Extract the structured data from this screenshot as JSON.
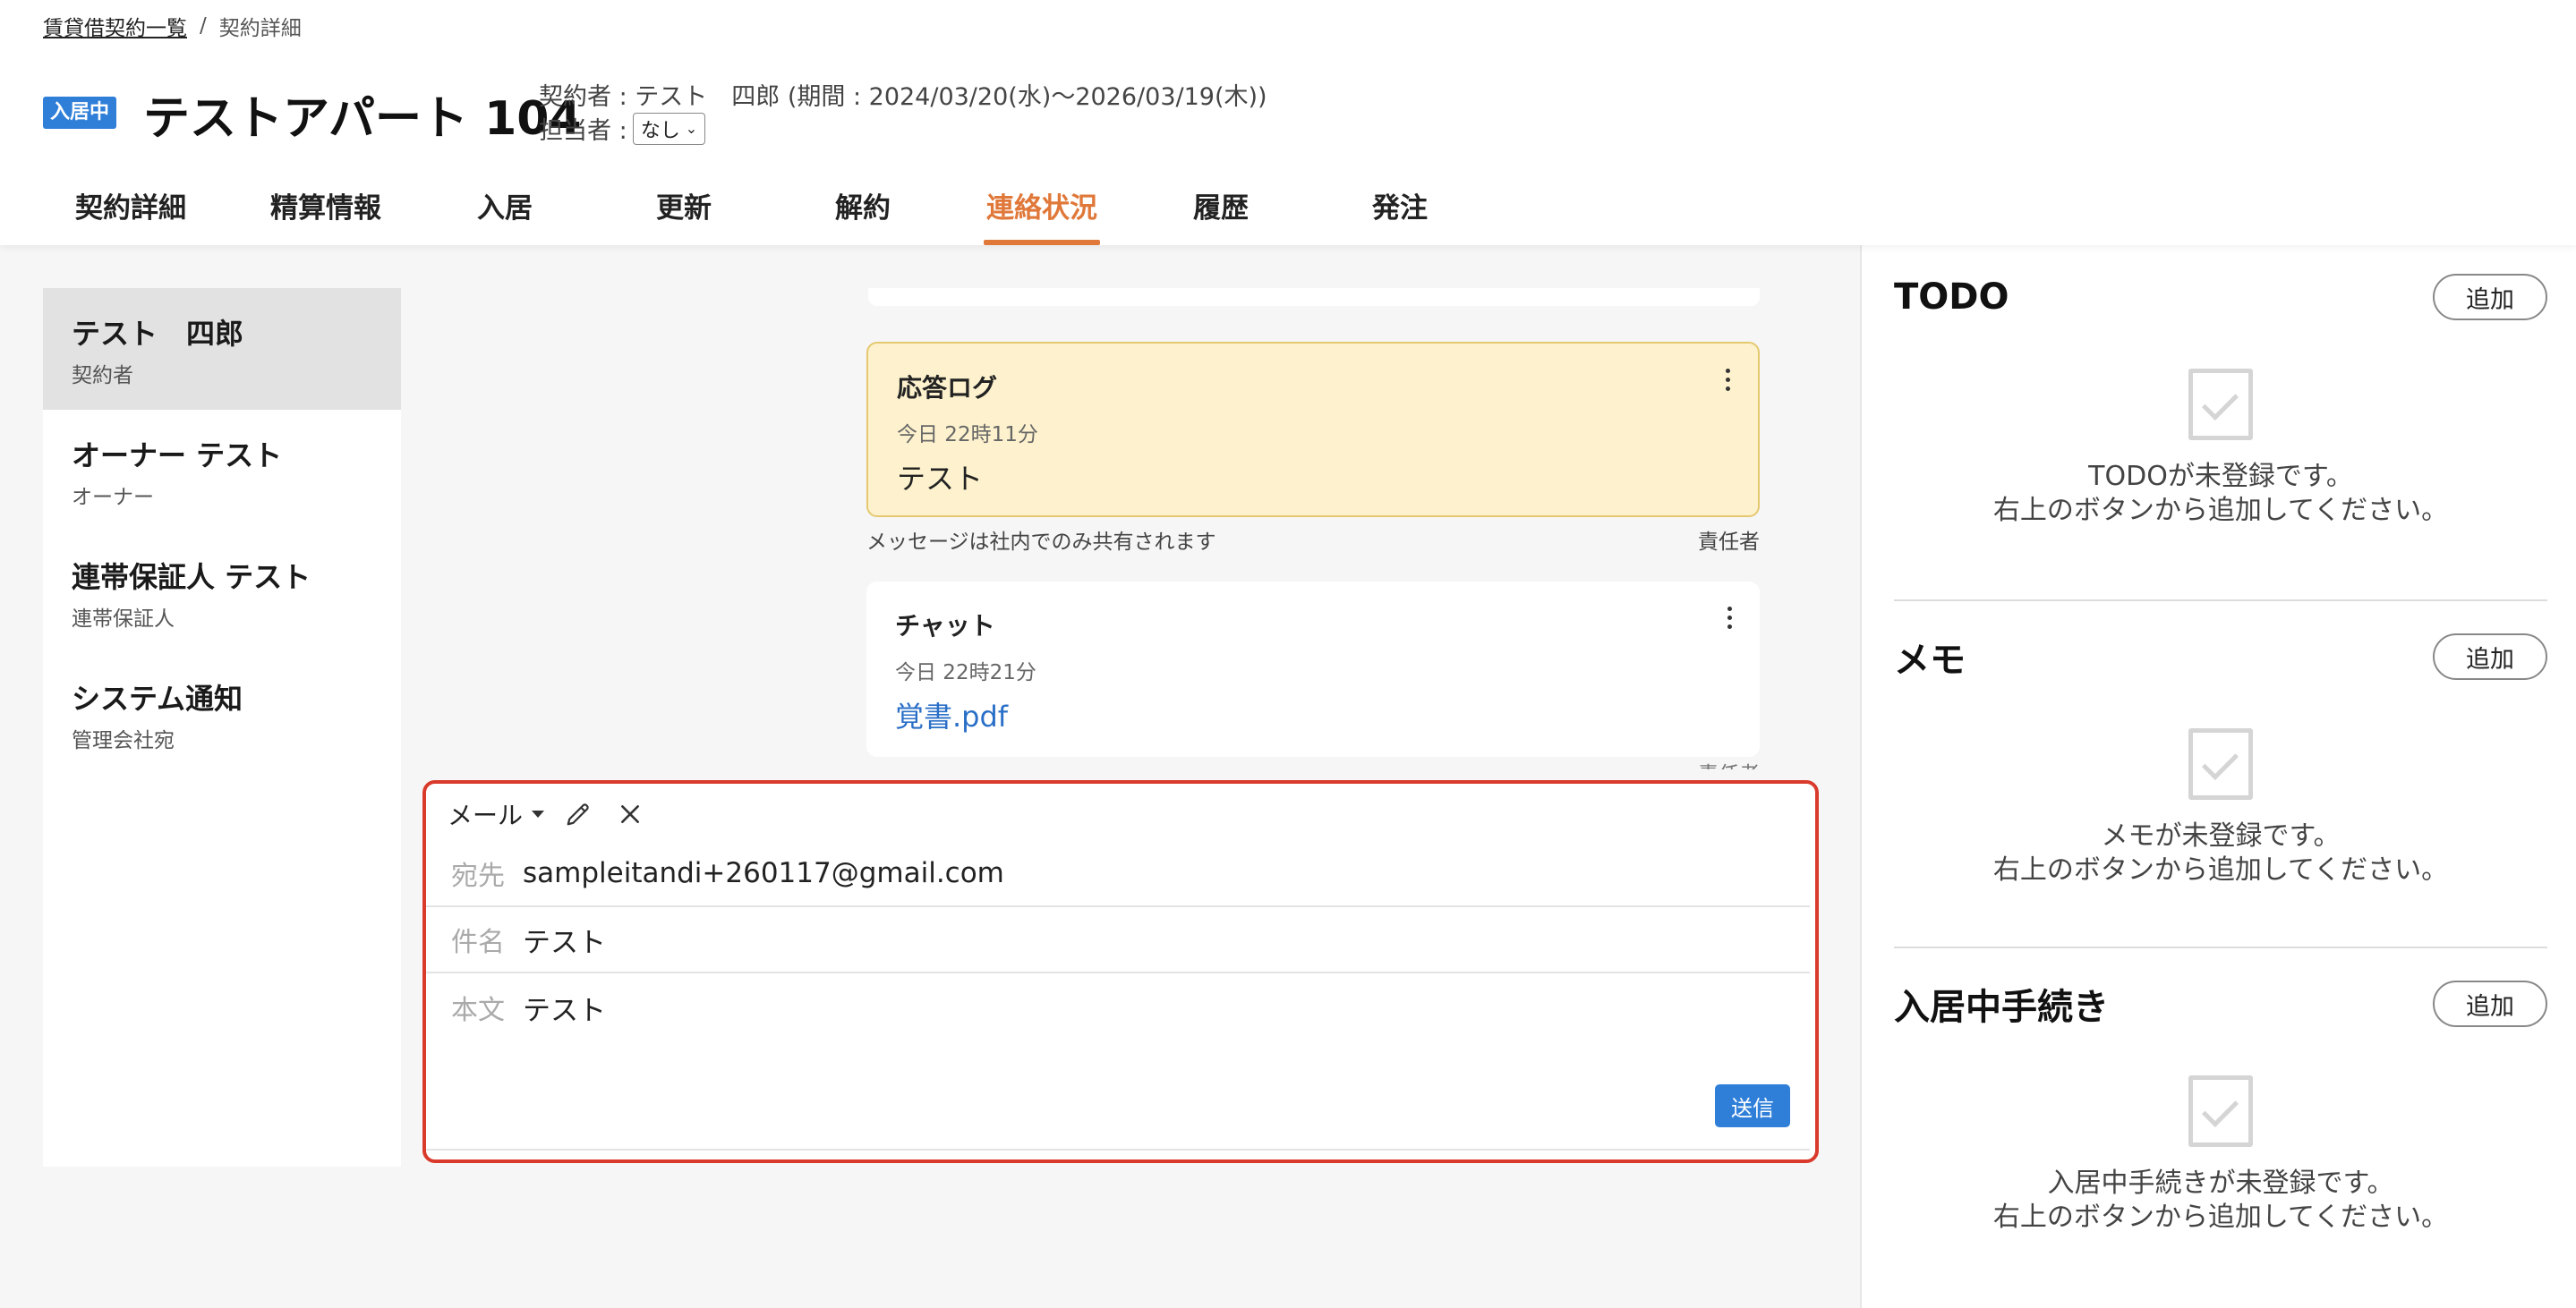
{
  "breadcrumb": {
    "parent": "賃貸借契約一覧",
    "separator": "/",
    "current": "契約詳細"
  },
  "header": {
    "status_badge": "入居中",
    "title": "テストアパート 104",
    "contract_line": "契約者 : テスト　四郎 (期間 : 2024/03/20(水)〜2026/03/19(木))",
    "assignee_label": "担当者 :",
    "assignee_value": "なし"
  },
  "tabs": [
    {
      "label": "契約詳細"
    },
    {
      "label": "精算情報"
    },
    {
      "label": "入居"
    },
    {
      "label": "更新"
    },
    {
      "label": "解約"
    },
    {
      "label": "連絡状況",
      "active": true
    },
    {
      "label": "履歴"
    },
    {
      "label": "発注"
    }
  ],
  "contacts": [
    {
      "name": "テスト　四郎",
      "role": "契約者",
      "active": true
    },
    {
      "name": "オーナー テスト",
      "role": "オーナー"
    },
    {
      "name": "連帯保証人 テスト",
      "role": "連帯保証人"
    },
    {
      "name": "システム通知",
      "role": "管理会社宛"
    }
  ],
  "messages": {
    "log": {
      "title": "応答ログ",
      "time": "今日 22時11分",
      "text": "テスト"
    },
    "log_note": {
      "left": "メッセージは社内でのみ共有されます",
      "right": "責任者"
    },
    "chat": {
      "title": "チャット",
      "time": "今日 22時21分",
      "file": "覚書.pdf"
    },
    "chat_note_right": "責任者"
  },
  "compose": {
    "type": "メール",
    "to_label": "宛先",
    "to_value": "sampleitandi+260117@gmail.com",
    "subject_label": "件名",
    "subject_value": "テスト",
    "body_label": "本文",
    "body_value": "テスト",
    "send_label": "送信"
  },
  "panel": {
    "todo": {
      "title": "TODO",
      "add": "追加",
      "empty_line1": "TODOが未登録です。",
      "empty_line2": "右上のボタンから追加してください。"
    },
    "memo": {
      "title": "メモ",
      "add": "追加",
      "empty_line1": "メモが未登録です。",
      "empty_line2": "右上のボタンから追加してください。"
    },
    "procedure": {
      "title": "入居中手続き",
      "add": "追加",
      "empty_line1": "入居中手続きが未登録です。",
      "empty_line2": "右上のボタンから追加してください。"
    }
  },
  "colors": {
    "accent": "#e0783a",
    "primary": "#2f7fd9",
    "highlight_border": "#d93a2b",
    "log_bg": "#fdf2cd"
  }
}
